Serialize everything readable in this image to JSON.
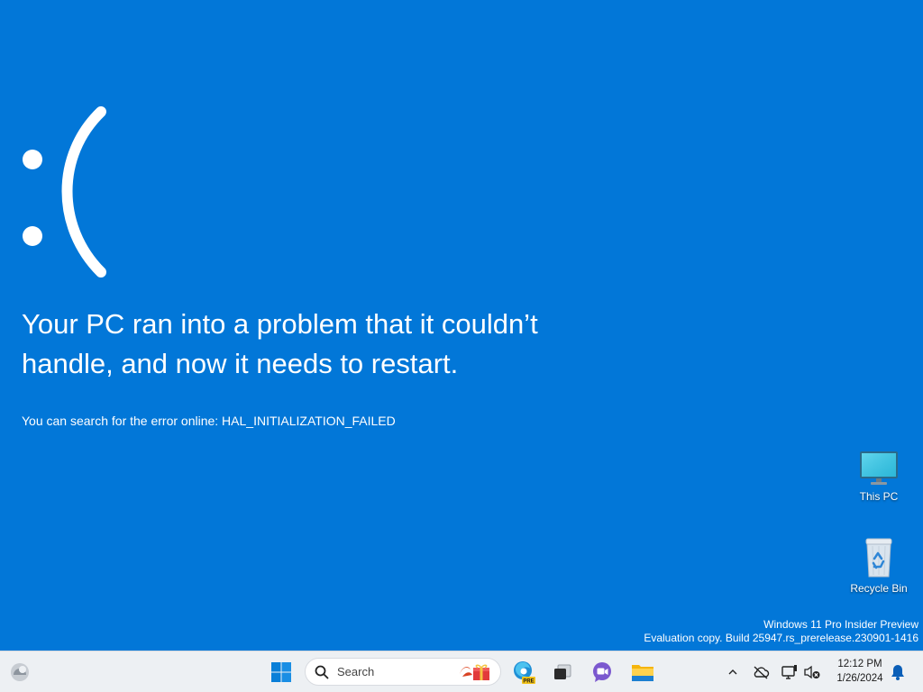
{
  "bsod": {
    "sad_face": ":(",
    "headline_line1": "Your PC ran into a problem that it couldn’t",
    "headline_line2": "handle, and now it needs to restart.",
    "search_text": "You can search for the error online: HAL_INITIALIZATION_FAILED",
    "background_color": "#0277d8"
  },
  "desktop_icons": [
    {
      "label": "This PC",
      "icon": "monitor-icon"
    },
    {
      "label": "Recycle Bin",
      "icon": "recycle-bin-icon"
    }
  ],
  "watermark": {
    "line1": "Windows 11 Pro Insider Preview",
    "line2": "Evaluation copy. Build 25947.rs_prerelease.230901-1416"
  },
  "taskbar": {
    "widgets_icon": "weather-widget-icon",
    "start_icon": "windows-start-icon",
    "search_placeholder": "Search",
    "search_icon": "search-icon",
    "search_highlight_icon": "gift-icon",
    "pinned": [
      {
        "name": "Microsoft Edge Preview",
        "icon": "edge-pre-icon",
        "badge": "PRE"
      },
      {
        "name": "Task View",
        "icon": "task-view-icon"
      },
      {
        "name": "Teams Chat",
        "icon": "chat-icon"
      },
      {
        "name": "File Explorer",
        "icon": "folder-icon"
      }
    ],
    "tray": {
      "overflow_icon": "chevron-up-icon",
      "onedrive_icon": "cloud-offline-icon",
      "network_icon": "network-icon",
      "volume_icon": "volume-muted-icon",
      "time": "12:12 PM",
      "date": "1/26/2024",
      "notification_icon": "bell-icon"
    },
    "accent_color": "#0067c0"
  }
}
